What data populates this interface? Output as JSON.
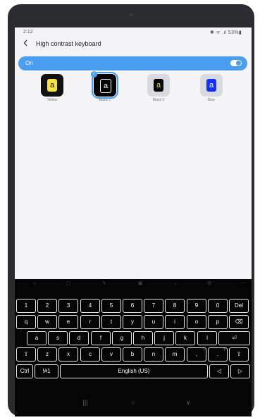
{
  "status": {
    "time": "2:12",
    "right": "✱ ᯤ .ıl 53%▮"
  },
  "header": {
    "back_icon": "chevron-left-icon",
    "title": "High contrast keyboard"
  },
  "toggle": {
    "label": "On",
    "state": "on"
  },
  "options": [
    {
      "label": "Yellow",
      "bg": "#111111",
      "key_bg": "#f5e243",
      "key_fg": "#111111",
      "glyph": "a",
      "selected": false
    },
    {
      "label": "Black 1",
      "bg": "#050505",
      "key_bg": "#050505",
      "key_fg": "#ffffff",
      "glyph": "a",
      "selected": true
    },
    {
      "label": "Black 2",
      "bg": "#d9dadf",
      "key_bg": "#000000",
      "key_fg": "#f5e243",
      "glyph": "a",
      "selected": false
    },
    {
      "label": "Blue",
      "bg": "#d9dadf",
      "key_bg": "#1431f0",
      "key_fg": "#ffffff",
      "glyph": "a",
      "selected": false
    }
  ],
  "keyboard": {
    "toolbar_icons": [
      "emoji-icon",
      "sticker-icon",
      "gif-icon",
      "clipboard-icon",
      "mic-icon",
      "settings-icon",
      "more-icon"
    ],
    "row1": [
      {
        "l": "1",
        "s": ""
      },
      {
        "l": "2",
        "s": ""
      },
      {
        "l": "3",
        "s": ""
      },
      {
        "l": "4",
        "s": ""
      },
      {
        "l": "5",
        "s": ""
      },
      {
        "l": "6",
        "s": ""
      },
      {
        "l": "7",
        "s": ""
      },
      {
        "l": "8",
        "s": ""
      },
      {
        "l": "9",
        "s": ""
      },
      {
        "l": "0",
        "s": ""
      },
      {
        "l": "Del",
        "s": ""
      }
    ],
    "row2": [
      {
        "l": "q",
        "s": ""
      },
      {
        "l": "w",
        "s": ""
      },
      {
        "l": "e",
        "s": ""
      },
      {
        "l": "r",
        "s": ""
      },
      {
        "l": "t",
        "s": ""
      },
      {
        "l": "y",
        "s": ""
      },
      {
        "l": "u",
        "s": ""
      },
      {
        "l": "i",
        "s": ""
      },
      {
        "l": "o",
        "s": ""
      },
      {
        "l": "p",
        "s": ""
      },
      {
        "l": "⌫",
        "s": ""
      }
    ],
    "row3": [
      {
        "l": "a",
        "s": ""
      },
      {
        "l": "s",
        "s": ""
      },
      {
        "l": "d",
        "s": ""
      },
      {
        "l": "f",
        "s": ""
      },
      {
        "l": "g",
        "s": ""
      },
      {
        "l": "h",
        "s": ""
      },
      {
        "l": "j",
        "s": ""
      },
      {
        "l": "k",
        "s": ""
      },
      {
        "l": "l",
        "s": ""
      },
      {
        "l": "⏎",
        "s": ""
      }
    ],
    "row4": [
      {
        "l": "⇧",
        "s": ""
      },
      {
        "l": "z",
        "s": ""
      },
      {
        "l": "x",
        "s": ""
      },
      {
        "l": "c",
        "s": ""
      },
      {
        "l": "v",
        "s": ""
      },
      {
        "l": "b",
        "s": ""
      },
      {
        "l": "n",
        "s": ""
      },
      {
        "l": "m",
        "s": ""
      },
      {
        "l": ",",
        "s": "!"
      },
      {
        "l": ".",
        "s": "?"
      },
      {
        "l": "⇧",
        "s": ""
      }
    ],
    "row5": [
      {
        "l": "Ctrl",
        "s": ""
      },
      {
        "l": "!#1",
        "s": ""
      },
      {
        "l": "English (US)",
        "s": ""
      },
      {
        "l": "◁",
        "s": ""
      },
      {
        "l": "▷",
        "s": ""
      }
    ]
  },
  "nav": {
    "recents": "|||",
    "home": "○",
    "back": "∨"
  }
}
